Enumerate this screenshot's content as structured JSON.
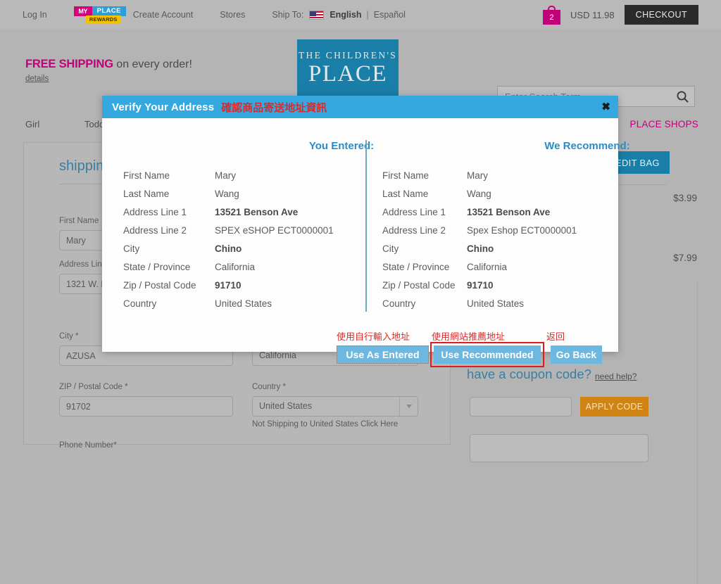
{
  "utility_bar": {
    "login": "Log In",
    "rewards_logo": {
      "my": "MY",
      "place": "PLACE",
      "rewards": "REWARDS"
    },
    "create_account": "Create Account",
    "stores": "Stores",
    "ship_to_label": "Ship To:",
    "flag_icon": "us-flag-icon",
    "lang_en": "English",
    "lang_sep": "|",
    "lang_es": "Español",
    "bag_icon": "shopping-bag-icon",
    "bag_count": "2",
    "cart_total": "USD 11.98",
    "checkout": "CHECKOUT"
  },
  "header": {
    "promo_bold": "FREE SHIPPING",
    "promo_rest": " on every order!",
    "details": "details",
    "logo_line1": "THE CHILDREN'S",
    "logo_line2": "PLACE",
    "search_placeholder": "Enter Search Term",
    "search_value": "",
    "search_icon": "magnifier-icon"
  },
  "nav": {
    "girl": "Girl",
    "toddler": "Todd",
    "place_shops": "PLACE SHOPS"
  },
  "shipping_form": {
    "title": "shipping",
    "first_name_label": "First Name",
    "first_name_value": "Mary",
    "address1_label": "Address Lin",
    "address1_value": "1321 W. Fo",
    "city_label": "City *",
    "city_value": "AZUSA",
    "zip_label": "ZIP / Postal Code *",
    "zip_value": "91702",
    "phone_label": "Phone Number*",
    "state_value": "California",
    "country_label": "Country *",
    "country_value": "United States",
    "not_shipping_note": "Not Shipping to United States Click Here",
    "caret_icon": "chevron-down-icon"
  },
  "right_rail": {
    "edit_bag": "EDIT BAG",
    "price_1": "$3.99",
    "price_2": "$7.99",
    "coupon_title": "have a coupon code?",
    "need_help": "need help?",
    "coupon_value": "",
    "apply_code": "APPLY CODE"
  },
  "modal": {
    "title": "Verify Your Address",
    "title_cn": "確認商品寄送地址資訊",
    "close_icon": "close-icon",
    "close_label": "✖",
    "left_heading": "You Entered:",
    "right_heading": "We Recommend:",
    "labels": [
      "First Name",
      "Last Name",
      "Address Line 1",
      "Address Line 2",
      "City",
      "State / Province",
      "Zip / Postal Code",
      "Country"
    ],
    "entered_values": [
      "Mary",
      "Wang",
      "13521 Benson Ave",
      "SPEX eSHOP ECT0000001",
      "Chino",
      "California",
      "91710",
      "United States"
    ],
    "recommended_values": [
      "Mary",
      "Wang",
      "13521 Benson Ave",
      "Spex Eshop ECT0000001",
      "Chino",
      "California",
      "91710",
      "United States"
    ],
    "bold_flags": [
      false,
      false,
      true,
      false,
      true,
      false,
      true,
      false
    ],
    "annotation_use_as_entered": "使用自行輸入地址",
    "annotation_use_recommended": "使用網站推薦地址",
    "annotation_go_back": "返回",
    "btn_use_as_entered": "Use As Entered",
    "btn_use_recommended": "Use Recommended",
    "btn_go_back": "Go Back",
    "highlight_color": "#e01b1b",
    "header_color": "#35a8e0",
    "button_color": "#6cb8e0"
  }
}
